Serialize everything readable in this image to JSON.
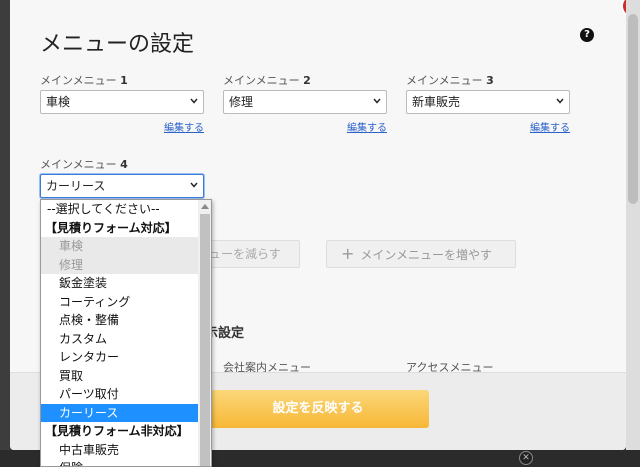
{
  "modal": {
    "title": "メニューの設定",
    "help_icon": "question-circle-icon"
  },
  "menus": [
    {
      "label": "メインメニュー",
      "number": "1",
      "value": "車検",
      "edit": "編集する"
    },
    {
      "label": "メインメニュー",
      "number": "2",
      "value": "修理",
      "edit": "編集する"
    },
    {
      "label": "メインメニュー",
      "number": "3",
      "value": "新車販売",
      "edit": "編集する"
    },
    {
      "label": "メインメニュー",
      "number": "4",
      "value": "カーリース"
    }
  ],
  "buttons": {
    "remove_label": "ューを減らす",
    "add_label": "メインメニューを増やす",
    "apply_label": "設定を反映する"
  },
  "section": {
    "title_fragment": "示設定",
    "col_company": "会社案内メニュー",
    "col_access": "アクセスメニュー"
  },
  "dropdown": {
    "items": [
      {
        "text": "--選択してください--",
        "kind": "placeholder"
      },
      {
        "text": "【見積りフォーム対応】",
        "kind": "group"
      },
      {
        "text": "車検",
        "kind": "disabled"
      },
      {
        "text": "修理",
        "kind": "disabled"
      },
      {
        "text": "鈑金塗装",
        "kind": "option"
      },
      {
        "text": "コーティング",
        "kind": "option"
      },
      {
        "text": "点検・整備",
        "kind": "option"
      },
      {
        "text": "カスタム",
        "kind": "option"
      },
      {
        "text": "レンタカー",
        "kind": "option"
      },
      {
        "text": "買取",
        "kind": "option"
      },
      {
        "text": "パーツ取付",
        "kind": "option"
      },
      {
        "text": "カーリース",
        "kind": "selected"
      },
      {
        "text": "【見積りフォーム非対応】",
        "kind": "group"
      },
      {
        "text": "中古車販売",
        "kind": "option"
      },
      {
        "text": "保険",
        "kind": "option"
      }
    ]
  },
  "colors": {
    "accent_orange": "#f7b736",
    "selected_blue": "#1e90ff",
    "link_blue": "#2a62c9"
  }
}
